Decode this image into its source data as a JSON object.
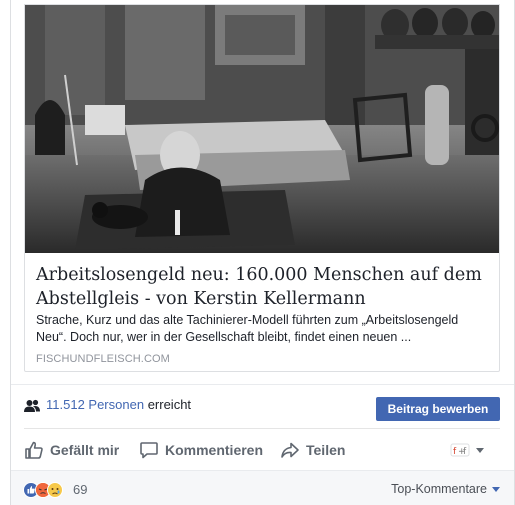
{
  "post": {
    "link": {
      "image_alt": "Black-and-white photo of a homeless man sitting on the floor of a station hall next to a dog and a makeshift bed",
      "title": "Arbeitslosengeld neu: 160.000 Menschen auf dem Abstellgleis - von Kerstin Kellermann",
      "description": "Strache, Kurz und das alte Tachinierer-Modell führten zum „Arbeitslosengeld Neu“. Doch nur, wer in der Gesellschaft bleibt, findet einen neuen ...",
      "domain": "FISCHUNDFLEISCH.COM"
    },
    "reach": {
      "count": "11.512 Personen",
      "suffix": "erreicht",
      "promote_label": "Beitrag bewerben"
    },
    "actions": {
      "like": "Gefällt mir",
      "comment": "Kommentieren",
      "share": "Teilen"
    },
    "reactions": {
      "count": "69",
      "types": [
        "like",
        "angry",
        "sad"
      ]
    },
    "comment_sort": "Top-Kommentare"
  },
  "colors": {
    "brand_blue": "#4267b2",
    "action_grey": "#606770",
    "meta_grey": "#90949c"
  }
}
